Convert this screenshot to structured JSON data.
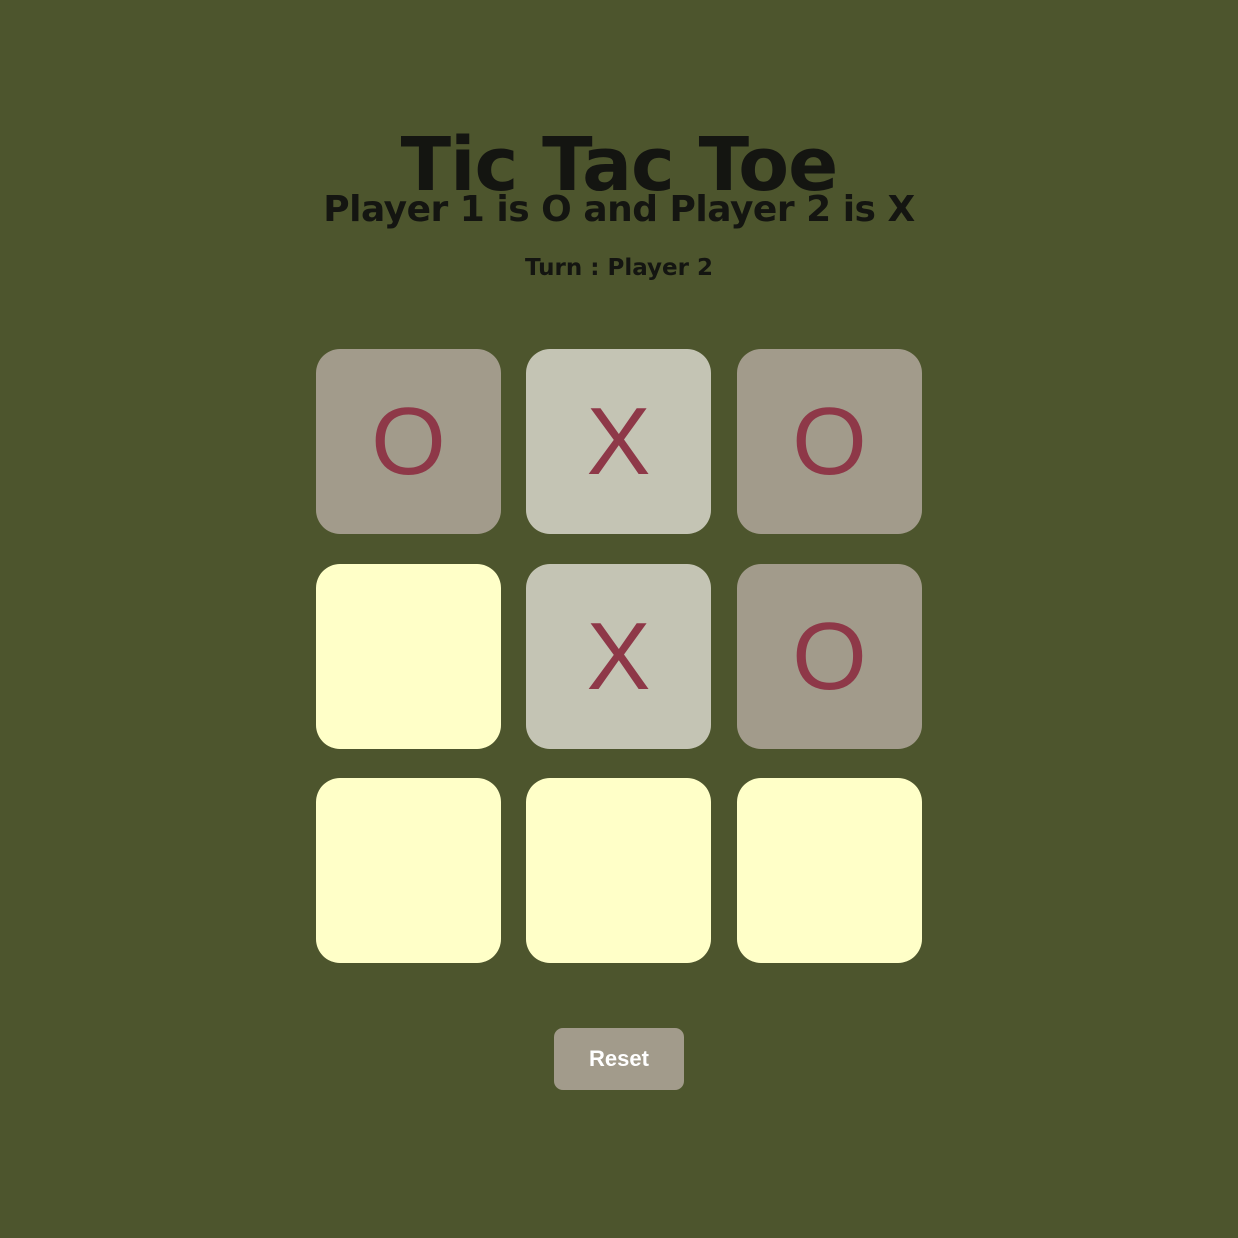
{
  "title": "Tic Tac Toe",
  "subtitle": "Player 1 is O and Player 2 is X",
  "turn": "Turn : Player 2",
  "board": {
    "cells": [
      {
        "value": "O",
        "state": "player1"
      },
      {
        "value": "X",
        "state": "player2"
      },
      {
        "value": "O",
        "state": "player1"
      },
      {
        "value": "",
        "state": "empty"
      },
      {
        "value": "X",
        "state": "player2"
      },
      {
        "value": "O",
        "state": "player1"
      },
      {
        "value": "",
        "state": "empty"
      },
      {
        "value": "",
        "state": "empty"
      },
      {
        "value": "",
        "state": "empty"
      }
    ]
  },
  "reset_label": "Reset",
  "colors": {
    "background": "#4d552d",
    "empty_cell": "#ffffc8",
    "o_cell": "#a29b8b",
    "x_cell": "#c4c4b4",
    "mark": "#8e3848",
    "text": "#141511",
    "button": "#a29b8b"
  }
}
